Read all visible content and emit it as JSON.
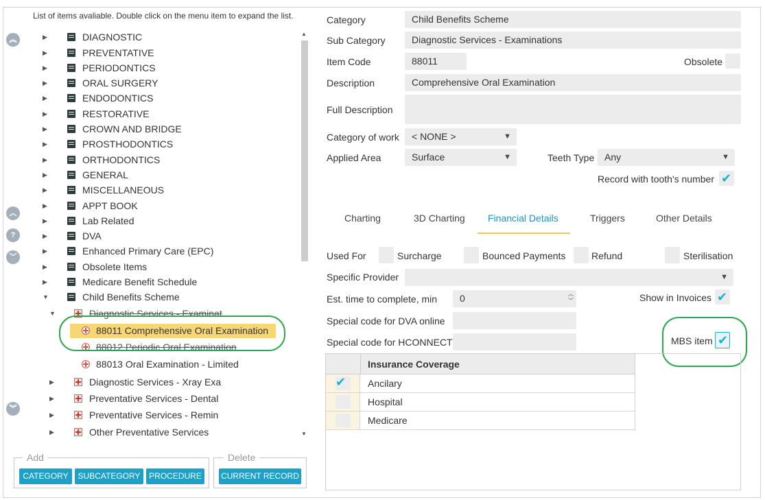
{
  "tree": {
    "hint": "List of items avaliable. Double click on the menu item to expand the list.",
    "categories": [
      "DIAGNOSTIC",
      "PREVENTATIVE",
      "PERIODONTICS",
      "ORAL SURGERY",
      "ENDODONTICS",
      "RESTORATIVE",
      "CROWN AND BRIDGE",
      "PROSTHODONTICS",
      "ORTHODONTICS",
      "GENERAL",
      "MISCELLANEOUS",
      "APPT BOOK",
      "Lab Related",
      "DVA",
      "Enhanced Primary Care (EPC)",
      "Obsolete Items",
      "Medicare Benefit Schedule",
      "Child Benefits Scheme"
    ],
    "expanded_sub": "Diagnostic Services - Examinat",
    "procedures": [
      "88011 Comprehensive Oral Examination",
      "88012 Periodic Oral Examination",
      "88013 Oral Examination - Limited"
    ],
    "subcategories": [
      "Diagnostic Services - Xray Exa",
      "Preventative Services - Dental",
      "Preventative Services -  Remin",
      "Other Preventative Services"
    ]
  },
  "toolbar": {
    "add_legend": "Add",
    "delete_legend": "Delete",
    "category": "CATEGORY",
    "subcategory": "SUBCATEGORY",
    "procedure": "PROCEDURE",
    "current_record": "CURRENT RECORD"
  },
  "form": {
    "category_label": "Category",
    "category": "Child Benefits Scheme",
    "subcategory_label": "Sub Category",
    "subcategory": "Diagnostic Services - Examinations",
    "item_code_label": "Item Code",
    "item_code": "88011",
    "obsolete_label": "Obsolete",
    "description_label": "Description",
    "description": "Comprehensive Oral Examination",
    "full_description_label": "Full Description",
    "full_description": "",
    "category_of_work_label": "Category of work",
    "category_of_work": "< NONE >",
    "applied_area_label": "Applied Area",
    "applied_area": "Surface",
    "teeth_type_label": "Teeth Type",
    "teeth_type": "Any",
    "record_tooth_label": "Record with tooth's number"
  },
  "tabs": [
    "Charting",
    "3D Charting",
    "Financial Details",
    "Triggers",
    "Other Details"
  ],
  "financial": {
    "used_for_label": "Used For",
    "surcharge": "Surcharge",
    "bounced": "Bounced Payments",
    "refund": "Refund",
    "sterilisation": "Sterilisation",
    "specific_provider_label": "Specific Provider",
    "specific_provider": "",
    "est_time_label": "Est. time to complete, min",
    "est_time": "0",
    "show_invoices_label": "Show in Invoices",
    "dva_label": "Special code for DVA online",
    "hconnect_label": "Special code for HCONNECT",
    "mbs_label": "MBS item",
    "insurance_header": "Insurance Coverage",
    "insurance": [
      {
        "name": "Ancilary",
        "checked": true
      },
      {
        "name": "Hospital",
        "checked": false
      },
      {
        "name": "Medicare",
        "checked": false
      }
    ]
  },
  "colors": {
    "accent": "#1da1c9",
    "selected": "#f7d674",
    "highlight_oval": "#2aa84a",
    "tab_underline": "#f5c84c"
  }
}
